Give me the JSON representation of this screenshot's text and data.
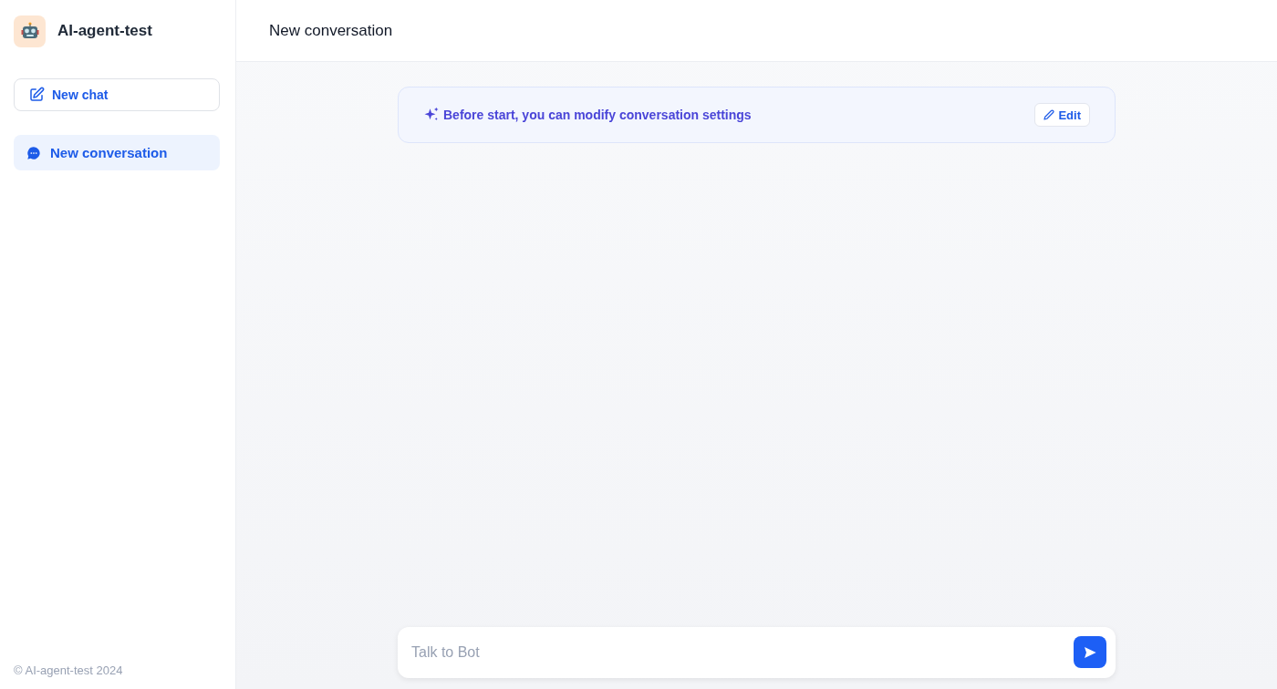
{
  "sidebar": {
    "app_name": "AI-agent-test",
    "new_chat": "New chat",
    "conversations": [
      {
        "label": "New conversation",
        "selected": true
      }
    ],
    "footer": "© AI-agent-test 2024"
  },
  "header": {
    "title": "New conversation"
  },
  "banner": {
    "text": "Before start, you can modify conversation settings",
    "button": "Edit"
  },
  "composer": {
    "placeholder": "Talk to Bot"
  }
}
